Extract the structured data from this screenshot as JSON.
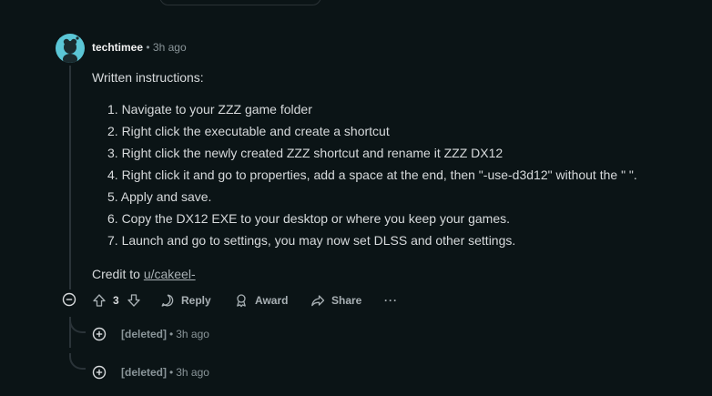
{
  "comment": {
    "author": "techtimee",
    "separator": "•",
    "time": "3h ago",
    "intro": "Written instructions:",
    "steps": [
      "1. Navigate to your ZZZ game folder",
      "2. Right click the executable and create a shortcut",
      "3. Right click the newly created ZZZ shortcut and rename it ZZZ DX12",
      "4. Right click it and go to properties, add a space at the end, then \"-use-d3d12\" without the \" \".",
      "5. Apply and save.",
      "6. Copy the DX12 EXE to your desktop or where you keep your games.",
      "7. Launch and go to settings, you may now set DLSS and other settings."
    ],
    "credit_prefix": "Credit to ",
    "credit_link": "u/cakeel-",
    "votes": "3",
    "reply_label": "Reply",
    "award_label": "Award",
    "share_label": "Share",
    "more_label": "···"
  },
  "replies": [
    {
      "author": "[deleted]",
      "separator": "•",
      "time": "3h ago"
    },
    {
      "author": "[deleted]",
      "separator": "•",
      "time": "3h ago"
    }
  ],
  "colors": {
    "background": "#0b1416",
    "text": "#d7dadc",
    "muted": "#8a9599",
    "avatar": "#5bc6d6"
  }
}
